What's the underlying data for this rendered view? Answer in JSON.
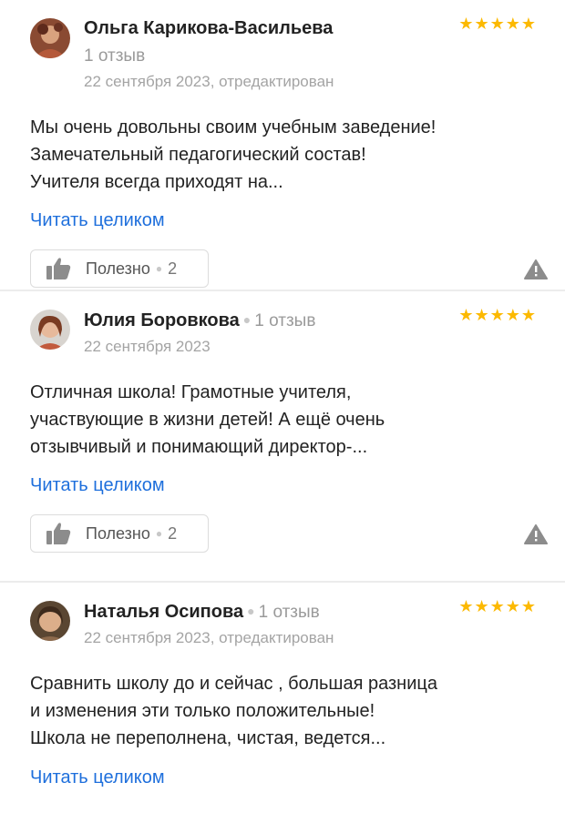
{
  "reviews": [
    {
      "author": "Ольга Карикова-Васильева",
      "reviews_count": "1 отзыв",
      "date": "22 сентября 2023, отредактирован",
      "rating": 5,
      "stars": "★★★★★",
      "text": "Мы очень довольны своим учебным заведение!\nЗамечательный педагогический состав!\nУчителя всегда приходят на...",
      "read_more": "Читать целиком",
      "helpful_label": "Полезно",
      "helpful_count": "2"
    },
    {
      "author": "Юлия Боровкова",
      "reviews_count": "1 отзыв",
      "date": "22 сентября 2023",
      "rating": 5,
      "stars": "★★★★★",
      "text": "Отличная школа! Грамотные учителя,\nучаствующие в жизни детей! А ещё очень\nотзывчивый и понимающий директор-...",
      "read_more": "Читать целиком",
      "helpful_label": "Полезно",
      "helpful_count": "2"
    },
    {
      "author": "Наталья Осипова",
      "reviews_count": "1 отзыв",
      "date": "22 сентября 2023, отредактирован",
      "rating": 5,
      "stars": "★★★★★",
      "text": "Сравнить школу до и сейчас , большая разница\nи изменения эти только положительные!\nШкола не переполнена, чистая, ведется...",
      "read_more": "Читать целиком"
    }
  ],
  "icons": {
    "thumb": "thumbs-up-icon",
    "report": "warning-triangle-icon",
    "star": "star-icon"
  },
  "colors": {
    "star": "#fcb900",
    "link": "#1e6fdc",
    "muted": "#a4a4a4",
    "icon": "#8c8c8c"
  }
}
